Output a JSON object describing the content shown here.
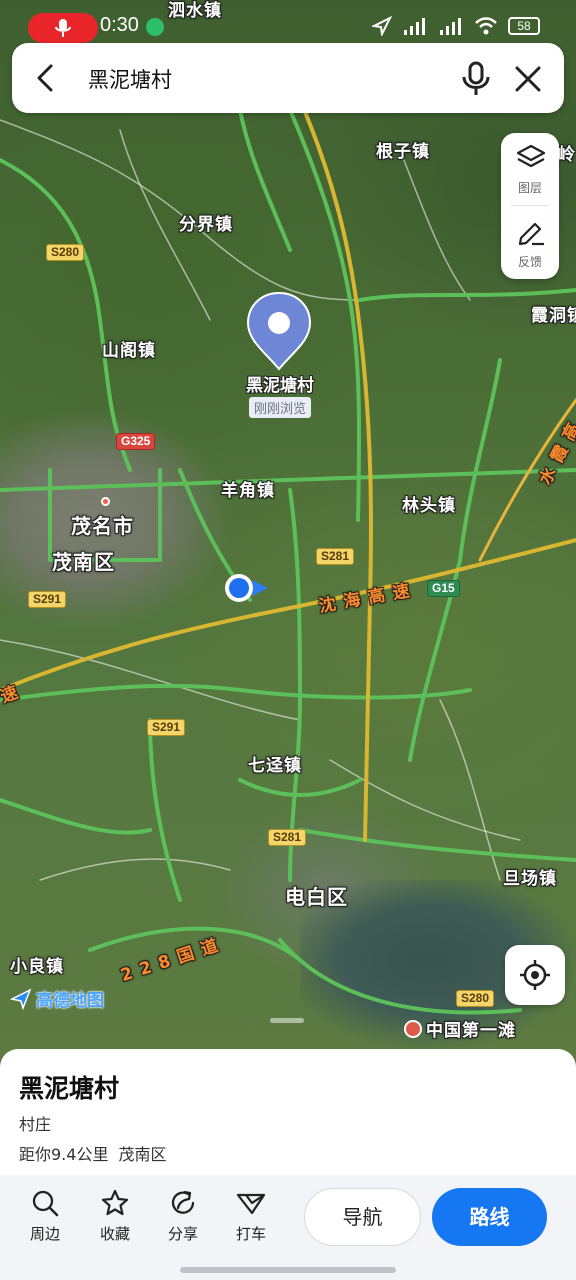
{
  "status_bar": {
    "time": "0:30",
    "battery": "58"
  },
  "search": {
    "query": "黑泥塘村"
  },
  "map": {
    "places": {
      "sishui": "泗水镇",
      "genzi": "根子镇",
      "ling": "岭",
      "fenjie": "分界镇",
      "xiadong": "霞洞镇",
      "shange": "山阁镇",
      "yangjiao": "羊角镇",
      "maoming": "茂名市",
      "maonan": "茂南区",
      "lintou": "林头镇",
      "qijing": "七迳镇",
      "dianbai": "电白区",
      "danchang": "旦场镇",
      "xiaoliang": "小良镇",
      "beach": "中国第一滩",
      "shenhai": "沈 海 高 速",
      "guodao": "2 2 8 国 道",
      "shuiyu": "水 霞 高",
      "su": "速"
    },
    "shields": {
      "s280a": "S280",
      "g325": "G325",
      "s281a": "S281",
      "g15": "G15",
      "s291a": "S291",
      "s291b": "S291",
      "s281b": "S281",
      "s280b": "S280"
    },
    "pin": {
      "name": "黑泥塘村",
      "tag": "刚刚浏览"
    },
    "watermark": "高德地图"
  },
  "tools": {
    "layers": "图层",
    "feedback": "反馈"
  },
  "sheet": {
    "title": "黑泥塘村",
    "type": "村庄",
    "distance": "距你9.4公里",
    "district": "茂南区",
    "actions": {
      "nearby": "周边",
      "favorite": "收藏",
      "share": "分享",
      "taxi": "打车"
    },
    "nav_button": "导航",
    "route_button": "路线"
  },
  "colors": {
    "accent": "#1677f2",
    "pin": "#6d86d6",
    "road": "#5cbf5a",
    "expressway": "#d8b632"
  }
}
